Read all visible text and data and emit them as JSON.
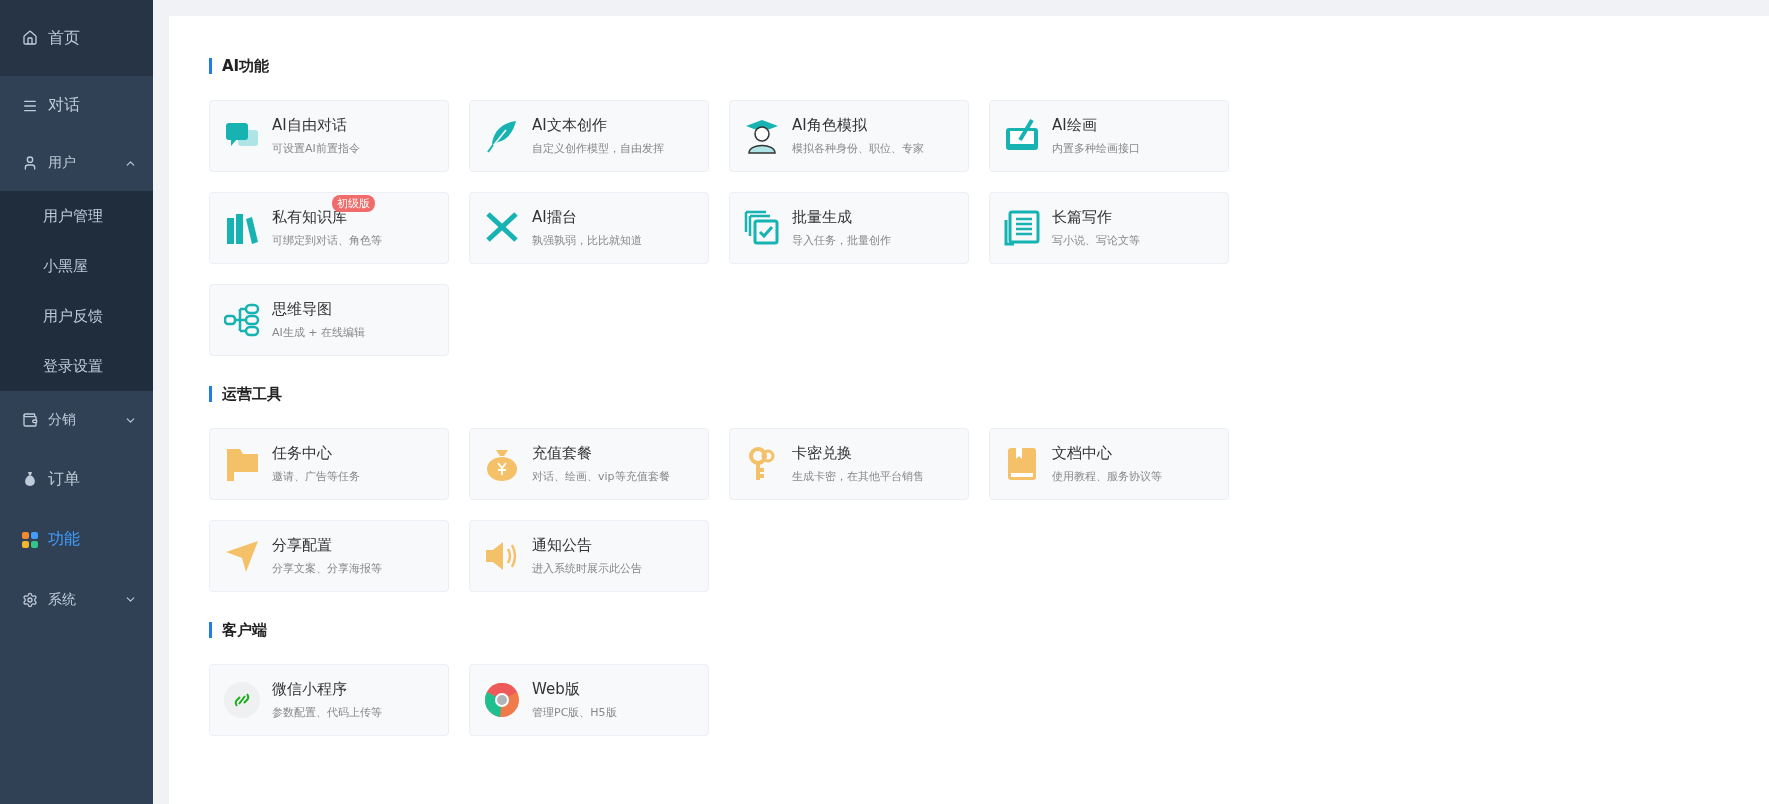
{
  "sidebar": {
    "items": [
      {
        "label": "首页",
        "selected": false
      },
      {
        "label": "对话",
        "selected": false
      },
      {
        "label": "用户",
        "selected": false,
        "expanded": true,
        "children": [
          {
            "label": "用户管理",
            "selected": false
          },
          {
            "label": "小黑屋",
            "selected": false
          },
          {
            "label": "用户反馈",
            "selected": false
          },
          {
            "label": "登录设置",
            "selected": false
          }
        ]
      },
      {
        "label": "分销",
        "selected": false,
        "expanded": false
      },
      {
        "label": "订单",
        "selected": false
      },
      {
        "label": "功能",
        "selected": true
      },
      {
        "label": "系统",
        "selected": false,
        "expanded": false
      }
    ]
  },
  "sections": [
    {
      "title": "AI功能",
      "cards": [
        {
          "title": "AI自由对话",
          "desc": "可设置AI前置指令"
        },
        {
          "title": "AI文本创作",
          "desc": "自定义创作模型，自由发挥"
        },
        {
          "title": "AI角色模拟",
          "desc": "模拟各种身份、职位、专家"
        },
        {
          "title": "AI绘画",
          "desc": "内置多种绘画接口"
        },
        {
          "title": "私有知识库",
          "desc": "可绑定到对话、角色等",
          "badge": "初级版"
        },
        {
          "title": "AI擂台",
          "desc": "孰强孰弱，比比就知道"
        },
        {
          "title": "批量生成",
          "desc": "导入任务，批量创作"
        },
        {
          "title": "长篇写作",
          "desc": "写小说、写论文等"
        },
        {
          "title": "思维导图",
          "desc": "AI生成 + 在线编辑"
        }
      ]
    },
    {
      "title": "运营工具",
      "cards": [
        {
          "title": "任务中心",
          "desc": "邀请、广告等任务"
        },
        {
          "title": "充值套餐",
          "desc": "对话、绘画、vip等充值套餐"
        },
        {
          "title": "卡密兑换",
          "desc": "生成卡密，在其他平台销售"
        },
        {
          "title": "文档中心",
          "desc": "使用教程、服务协议等"
        },
        {
          "title": "分享配置",
          "desc": "分享文案、分享海报等"
        },
        {
          "title": "通知公告",
          "desc": "进入系统时展示此公告"
        }
      ]
    },
    {
      "title": "客户端",
      "cards": [
        {
          "title": "微信小程序",
          "desc": "参数配置、代码上传等"
        },
        {
          "title": "Web版",
          "desc": "管理PC版、H5版"
        }
      ]
    }
  ]
}
